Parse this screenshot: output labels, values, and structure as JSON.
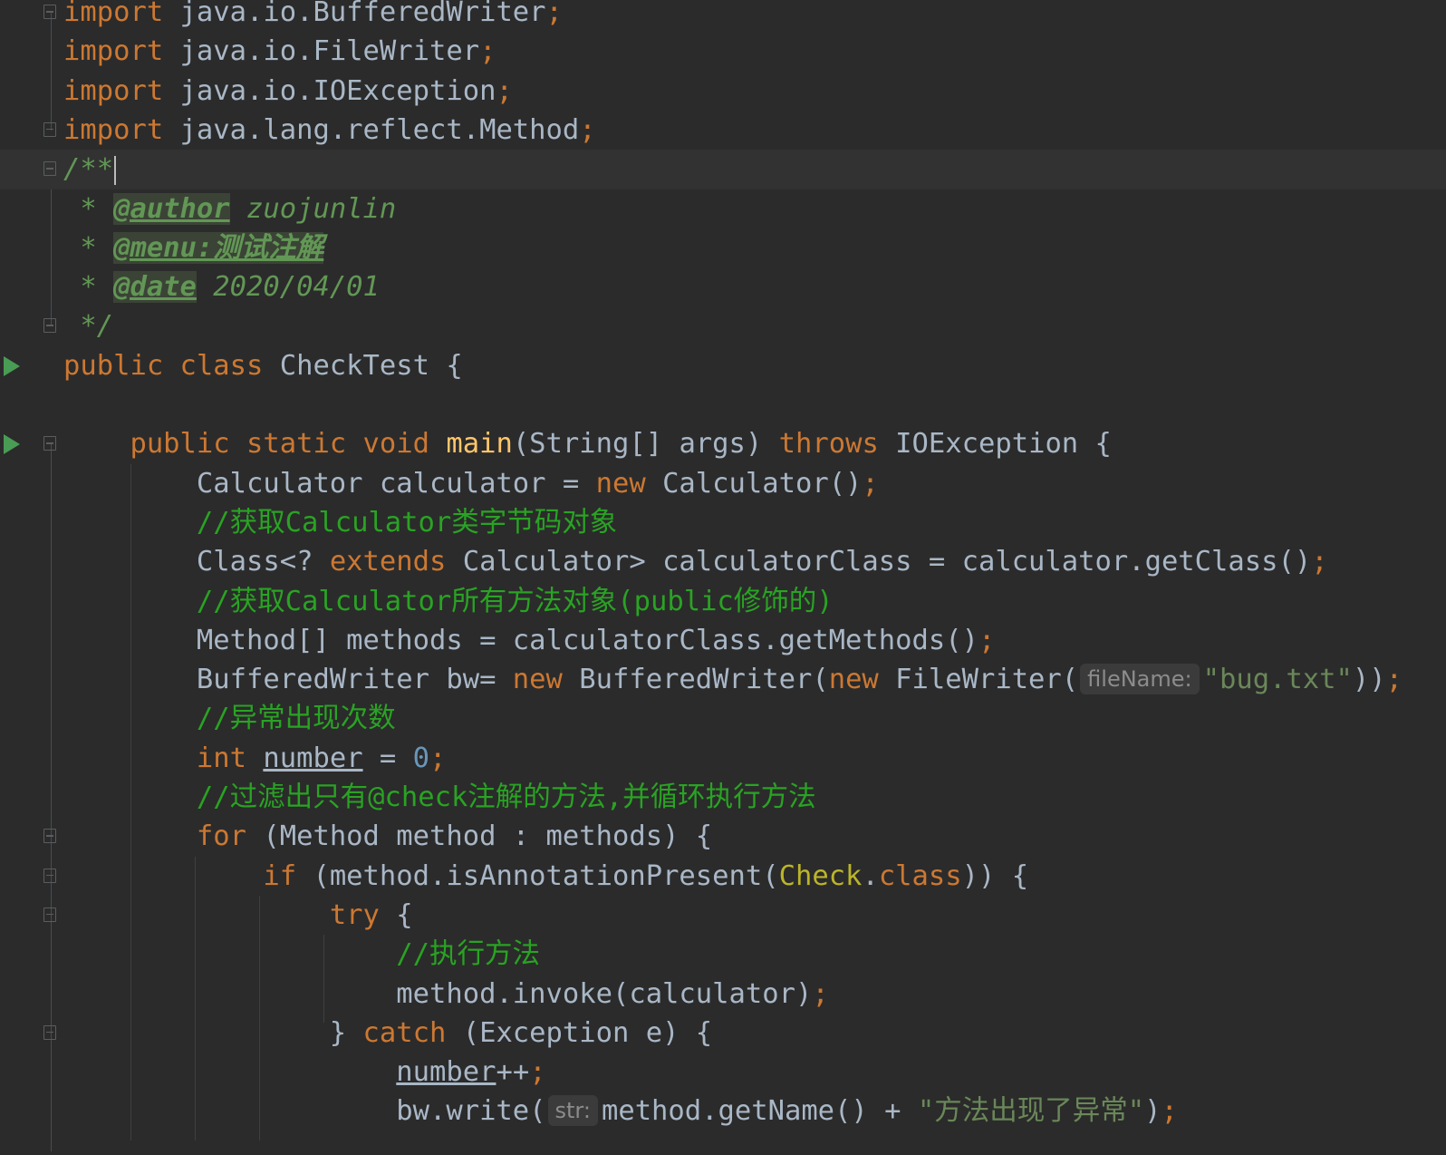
{
  "editor": {
    "language": "Java",
    "theme": "Darcula",
    "lines": [
      {
        "parts": [
          [
            "kw",
            "import"
          ],
          [
            "plain",
            " java.io.BufferedWriter"
          ],
          [
            "pn",
            ";"
          ]
        ]
      },
      {
        "parts": [
          [
            "kw",
            "import"
          ],
          [
            "plain",
            " java.io.FileWriter"
          ],
          [
            "pn",
            ";"
          ]
        ]
      },
      {
        "parts": [
          [
            "kw",
            "import"
          ],
          [
            "plain",
            " java.io.IOException"
          ],
          [
            "pn",
            ";"
          ]
        ]
      },
      {
        "parts": [
          [
            "kw",
            "import"
          ],
          [
            "plain",
            " java.lang.reflect.Method"
          ],
          [
            "pn",
            ";"
          ]
        ]
      },
      {
        "parts": [
          [
            "cm",
            "/**"
          ]
        ],
        "current": true,
        "caret": true
      },
      {
        "parts": [
          [
            "cm",
            " * "
          ],
          [
            "tag",
            "@author"
          ],
          [
            "tagval",
            " zuojunlin"
          ]
        ]
      },
      {
        "parts": [
          [
            "cm",
            " * "
          ],
          [
            "tag",
            "@menu:测试注解"
          ]
        ]
      },
      {
        "parts": [
          [
            "cm",
            " * "
          ],
          [
            "tag",
            "@date"
          ],
          [
            "tagval",
            " 2020/04/01"
          ]
        ]
      },
      {
        "parts": [
          [
            "cm",
            " */"
          ]
        ]
      },
      {
        "parts": [
          [
            "kw",
            "public class"
          ],
          [
            "plain",
            " CheckTest {"
          ]
        ],
        "run": true
      },
      {
        "parts": []
      },
      {
        "parts": [
          [
            "plain",
            "    "
          ],
          [
            "kw",
            "public static void"
          ],
          [
            "plain",
            " "
          ],
          [
            "fn",
            "main"
          ],
          [
            "plain",
            "(String[] args) "
          ],
          [
            "kw",
            "throws"
          ],
          [
            "plain",
            " IOException {"
          ]
        ],
        "run": true
      },
      {
        "parts": [
          [
            "plain",
            "        Calculator calculator = "
          ],
          [
            "kw",
            "new"
          ],
          [
            "plain",
            " Calculator()"
          ],
          [
            "pn",
            ";"
          ]
        ]
      },
      {
        "parts": [
          [
            "plain",
            "        "
          ],
          [
            "lc",
            "//获取Calculator类字节码对象"
          ]
        ]
      },
      {
        "parts": [
          [
            "plain",
            "        Class<? "
          ],
          [
            "kw",
            "extends"
          ],
          [
            "plain",
            " Calculator> calculatorClass = calculator.getClass()"
          ],
          [
            "pn",
            ";"
          ]
        ]
      },
      {
        "parts": [
          [
            "plain",
            "        "
          ],
          [
            "lc",
            "//获取Calculator所有方法对象(public修饰的)"
          ]
        ]
      },
      {
        "parts": [
          [
            "plain",
            "        Method[] methods = calculatorClass.getMethods()"
          ],
          [
            "pn",
            ";"
          ]
        ]
      },
      {
        "parts": [
          [
            "plain",
            "        BufferedWriter bw= "
          ],
          [
            "kw",
            "new"
          ],
          [
            "plain",
            " BufferedWriter("
          ],
          [
            "kw",
            "new"
          ],
          [
            "plain",
            " FileWriter("
          ],
          [
            "hint",
            "fileName:"
          ],
          [
            "str",
            "\"bug.txt\""
          ],
          [
            "plain",
            "))"
          ],
          [
            "pn",
            ";"
          ]
        ]
      },
      {
        "parts": [
          [
            "plain",
            "        "
          ],
          [
            "lc",
            "//异常出现次数"
          ]
        ]
      },
      {
        "parts": [
          [
            "plain",
            "        "
          ],
          [
            "kw",
            "int"
          ],
          [
            "plain",
            " "
          ],
          [
            "var",
            "number"
          ],
          [
            "plain",
            " = "
          ],
          [
            "num",
            "0"
          ],
          [
            "pn",
            ";"
          ]
        ]
      },
      {
        "parts": [
          [
            "plain",
            "        "
          ],
          [
            "lc",
            "//过滤出只有@check注解的方法,并循环执行方法"
          ]
        ]
      },
      {
        "parts": [
          [
            "plain",
            "        "
          ],
          [
            "kw",
            "for"
          ],
          [
            "plain",
            " (Method method : methods) {"
          ]
        ]
      },
      {
        "parts": [
          [
            "plain",
            "            "
          ],
          [
            "kw",
            "if"
          ],
          [
            "plain",
            " (method.isAnnotationPresent("
          ],
          [
            "ann",
            "Check"
          ],
          [
            "plain",
            "."
          ],
          [
            "kw",
            "class"
          ],
          [
            "plain",
            ")) {"
          ]
        ]
      },
      {
        "parts": [
          [
            "plain",
            "                "
          ],
          [
            "kw",
            "try"
          ],
          [
            "plain",
            " {"
          ]
        ]
      },
      {
        "parts": [
          [
            "plain",
            "                    "
          ],
          [
            "lc",
            "//执行方法"
          ]
        ]
      },
      {
        "parts": [
          [
            "plain",
            "                    method.invoke(calculator)"
          ],
          [
            "pn",
            ";"
          ]
        ]
      },
      {
        "parts": [
          [
            "plain",
            "                } "
          ],
          [
            "kw",
            "catch"
          ],
          [
            "plain",
            " (Exception e) {"
          ]
        ]
      },
      {
        "parts": [
          [
            "plain",
            "                    "
          ],
          [
            "var",
            "number"
          ],
          [
            "plain",
            "++"
          ],
          [
            "pn",
            ";"
          ]
        ]
      },
      {
        "parts": [
          [
            "plain",
            "                    bw.write("
          ],
          [
            "hint",
            "str:"
          ],
          [
            "plain",
            "method.getName() + "
          ],
          [
            "str",
            "\"方法出现了异常\""
          ],
          [
            "plain",
            ")"
          ],
          [
            "pn",
            ";"
          ]
        ]
      }
    ]
  }
}
